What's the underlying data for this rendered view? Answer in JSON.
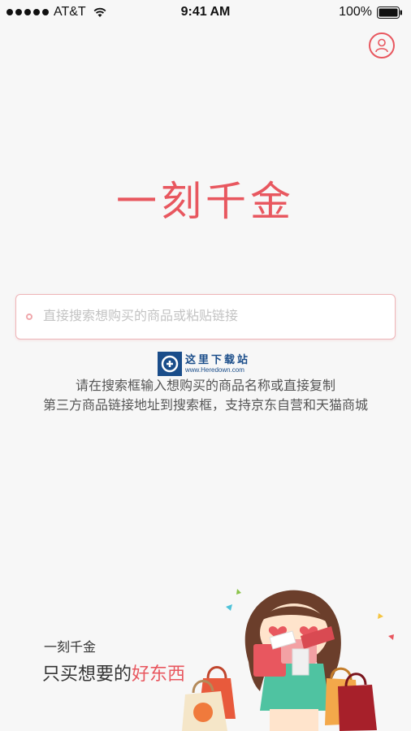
{
  "status_bar": {
    "carrier": "AT&T",
    "time": "9:41 AM",
    "battery": "100%"
  },
  "header": {
    "user_icon": "user-profile-icon"
  },
  "logo": {
    "text": "一刻千金"
  },
  "search": {
    "placeholder": "直接搜索想购买的商品或粘贴链接",
    "value": ""
  },
  "watermark": {
    "title": "这里下载站",
    "url": "www.Heredown.com"
  },
  "hint": {
    "line1": "请在搜索框输入想购买的商品名称或直接复制",
    "line2": "第三方商品链接地址到搜索框，支持京东自营和天猫商城"
  },
  "tagline": {
    "small": "一刻千金",
    "big_prefix": "只买想要的",
    "big_accent": "好东西"
  },
  "colors": {
    "accent": "#e8575f",
    "background": "#f7f7f7",
    "search_border": "#eeb5b8",
    "watermark_blue": "#1a4d8a"
  }
}
